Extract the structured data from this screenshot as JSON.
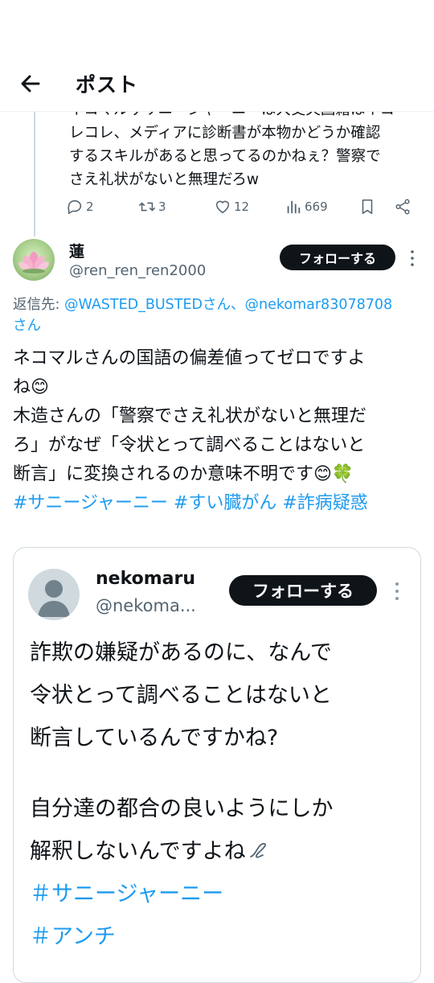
{
  "header": {
    "title": "ポスト",
    "back_icon": "arrow-left-icon"
  },
  "previous_post": {
    "text_lines": [
      "ネコマルザサニージャーニーは大丈夫国籍はネコ",
      "レコレ、メディアに診断書が本物かどうか確認",
      "するスキルがあると思ってるのかねぇ？警察で",
      "さえ礼状がないと無理だろw"
    ],
    "replies": "2",
    "reposts": "3",
    "likes": "12",
    "views": "669"
  },
  "post": {
    "name": "蓮",
    "handle": "@ren_ren_ren2000",
    "follow_label": "フォローする",
    "reply_prefix": "返信先: ",
    "reply_to_1": "@WASTED_BUSTEDさん、",
    "reply_to_2": "@nekomar83078708",
    "reply_to_suffix": "さん",
    "body_lines": [
      "ネコマルさんの国語の偏差値ってゼロですよ",
      "ね😊",
      "木造さんの「警察でさえ礼状がないと無理だ",
      "ろ」がなぜ「令状とって調べることはないと",
      "断言」に変換されるのか意味不明です😊🍀"
    ],
    "hashtags": "#サニージャーニー #すい臓がん #詐病疑惑"
  },
  "quote": {
    "name": "nekomaru",
    "handle": "@nekoma...",
    "follow_label": "フォローする",
    "body_lines": [
      "詐欺の嫌疑があるのに、なんで",
      "令状とって調べることはないと",
      "断言しているんですかね?"
    ],
    "body_lines_2": [
      "自分達の都合の良いようにしか",
      "解釈しないんですよね"
    ],
    "hashtag_1": "＃サニージャーニー",
    "hashtag_2": "＃アンチ"
  },
  "colors": {
    "accent": "#1d9bf0",
    "text": "#0f1419",
    "muted": "#536471",
    "button": "#0f1419"
  }
}
